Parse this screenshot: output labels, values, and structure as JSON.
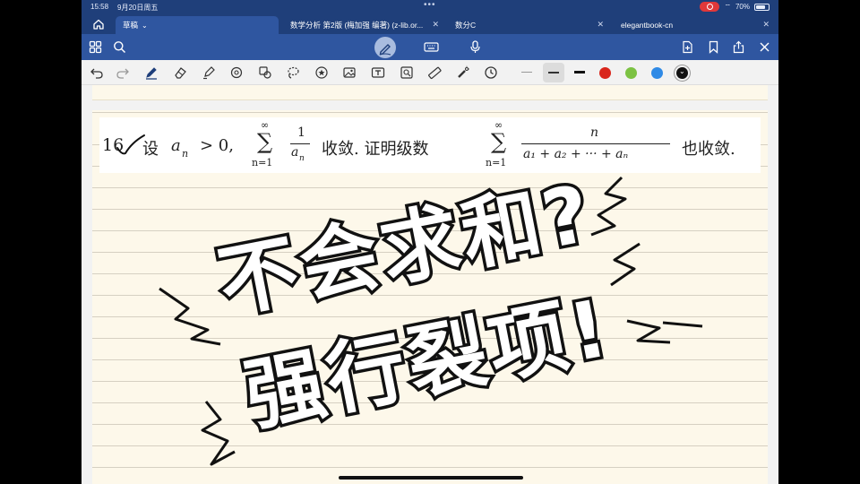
{
  "status_bar": {
    "time": "15:58",
    "date": "9月20日周五",
    "battery": "70%"
  },
  "tabs": [
    {
      "label": "草稿",
      "active": true
    },
    {
      "label": "数学分析 第2版 (梅加强 编著) (z-lib.or...",
      "active": false
    },
    {
      "label": "数分C",
      "active": false
    },
    {
      "label": "elegantbook-cn",
      "active": false
    }
  ],
  "colors": {
    "nav_blue": "#1f3f7a",
    "toolbar_blue": "#2f56a0",
    "paper": "#fdf8ea",
    "swatch_red": "#d9261c",
    "swatch_green": "#7cc243",
    "swatch_blue": "#2f8ae6",
    "swatch_black": "#111111"
  },
  "toolbar1_icons": [
    "home-icon",
    "grid-icon",
    "search-icon",
    "pen-mode-icon",
    "keyboard-icon",
    "microphone-icon",
    "add-page-icon",
    "bookmark-icon",
    "share-icon",
    "close-icon"
  ],
  "toolbar2_icons": [
    "undo-icon",
    "redo-icon",
    "pen-icon",
    "eraser-icon",
    "highlighter-icon",
    "shape-icon",
    "lasso-fill-icon",
    "lasso-icon",
    "star-icon",
    "image-icon",
    "textbox-icon",
    "image-search-icon",
    "ruler-icon",
    "laser-icon",
    "clock-icon"
  ],
  "problem": {
    "number": "16",
    "lead": "设",
    "condition": "a",
    "condition_sub": "n",
    "gt": "> 0,",
    "sum_top": "∞",
    "sum_bottom": "n=1",
    "frac1_num": "1",
    "frac1_den": "a",
    "frac1_den_sub": "n",
    "mid_text": "收敛. 证明级数",
    "sum2_top": "∞",
    "sum2_bottom": "n=1",
    "frac2_num": "n",
    "frac2_den": "a₁ + a₂ + ··· + aₙ",
    "end_text": "也收敛."
  },
  "caption": {
    "line1": "不会求和?",
    "line2": "强行裂项!"
  }
}
